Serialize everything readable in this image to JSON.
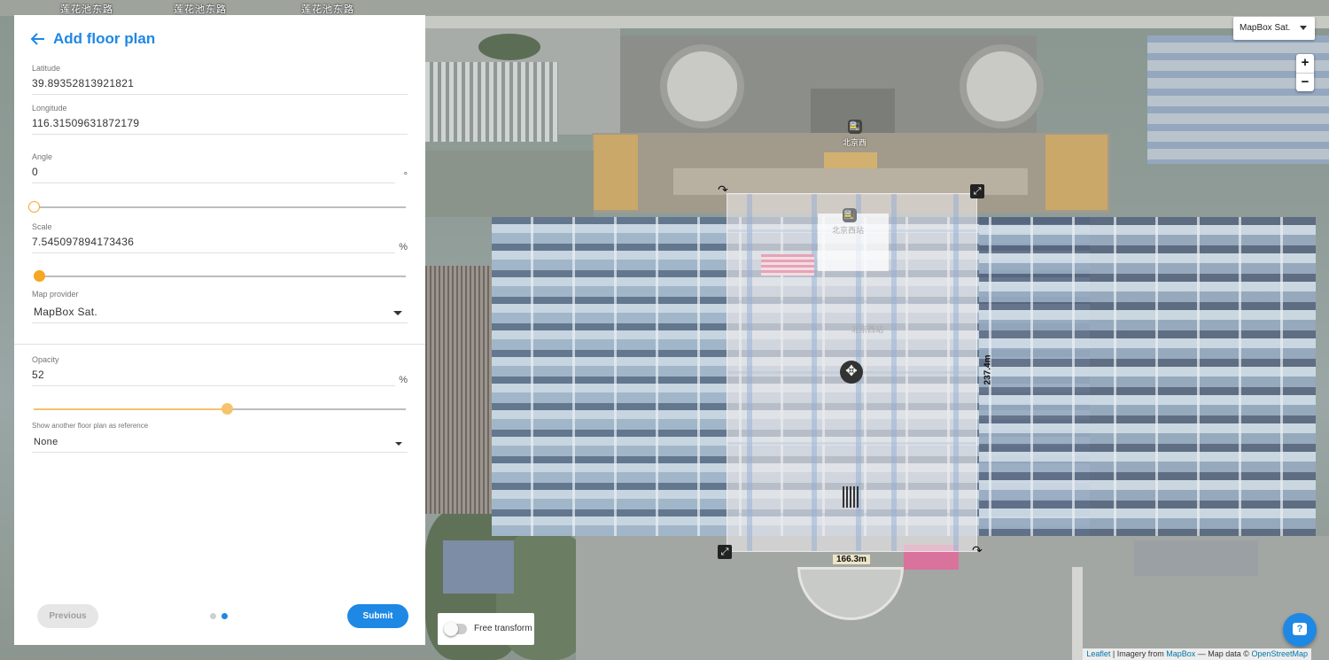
{
  "panel": {
    "title": "Add floor plan",
    "back_icon": "arrow-left-icon",
    "latitude": {
      "label": "Latitude",
      "value": "39.89352813921821"
    },
    "longitude": {
      "label": "Longitude",
      "value": "116.31509631872179"
    },
    "angle": {
      "label": "Angle",
      "value": "0",
      "unit": "°",
      "slider_fraction": 0.0
    },
    "scale": {
      "label": "Scale",
      "value": "7.545097894173436",
      "unit": "%",
      "slider_fraction": 0.015
    },
    "map_provider": {
      "label": "Map provider",
      "value": "MapBox Sat."
    },
    "opacity": {
      "label": "Opacity",
      "value": "52",
      "unit": "%",
      "slider_fraction": 0.52
    },
    "reference": {
      "label": "Show another floor plan as reference",
      "value": "None"
    },
    "previous_label": "Previous",
    "submit_label": "Submit",
    "steps": {
      "total": 2,
      "current": 2
    }
  },
  "map": {
    "provider_select": "MapBox Sat.",
    "zoom_in": "+",
    "zoom_out": "−",
    "street_labels": [
      "莲花池东路",
      "莲花池东路",
      "莲花池东路"
    ],
    "station_labels": [
      "北京西",
      "北京西站",
      "北京西站"
    ],
    "dimension_width": "166.3m",
    "dimension_height": "237.4m",
    "free_transform_label": "Free transform",
    "chat_icon": "help-chat-icon",
    "attribution": {
      "leaflet": "Leaflet",
      "imagery_prefix": " | Imagery from ",
      "mapbox": "MapBox",
      "data_prefix": " — Map data © ",
      "osm": "OpenStreetMap"
    }
  },
  "colors": {
    "accent": "#1e88e5",
    "slider_orange": "#f5a623",
    "slider_yellow": "#f5c36b",
    "dot_inactive": "#cfcfcf"
  }
}
